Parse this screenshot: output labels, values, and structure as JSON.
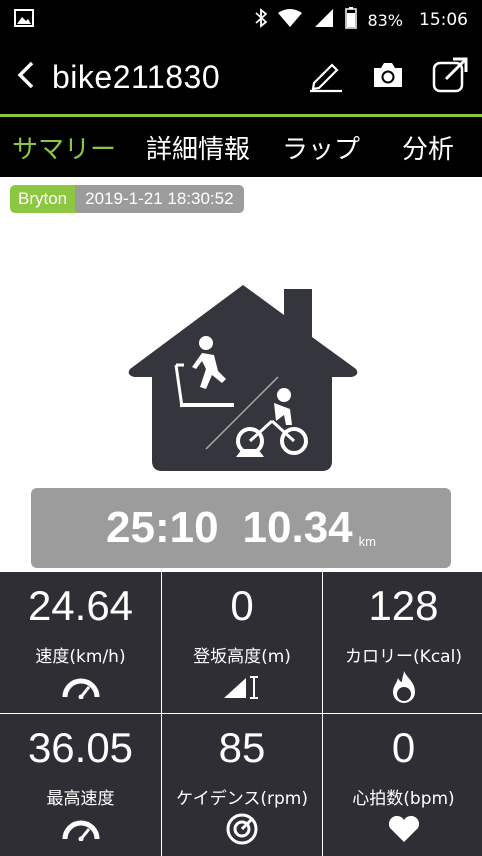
{
  "status_bar": {
    "battery": "83%",
    "time": "15:06"
  },
  "app_bar": {
    "title": "bike211830",
    "icons": [
      "back-arrow-icon",
      "pencil-icon",
      "camera-icon",
      "share-icon"
    ]
  },
  "tabs": [
    {
      "label": "サマリー",
      "active": true
    },
    {
      "label": "詳細情報",
      "active": false
    },
    {
      "label": "ラップ",
      "active": false
    },
    {
      "label": "分析",
      "active": false
    }
  ],
  "activity": {
    "brand": "Bryton",
    "datetime": "2019-1-21 18:30:52",
    "icon": "indoor-training-house-icon"
  },
  "summary": {
    "duration": "25:10",
    "distance": "10.34",
    "distance_unit": "km"
  },
  "stats": [
    {
      "value": "24.64",
      "label": "速度(km/h)",
      "icon": "speedometer-icon"
    },
    {
      "value": "0",
      "label": "登坂高度(m)",
      "icon": "elevation-icon"
    },
    {
      "value": "128",
      "label": "カロリー(Kcal)",
      "icon": "calorie-flame-icon"
    },
    {
      "value": "36.05",
      "label": "最高速度",
      "icon": "speedometer-icon"
    },
    {
      "value": "85",
      "label": "ケイデンス(rpm)",
      "icon": "cadence-icon"
    },
    {
      "value": "0",
      "label": "心拍数(bpm)",
      "icon": "heart-icon"
    }
  ],
  "colors": {
    "accent": "#8dc63f",
    "tile": "#2e2e34",
    "summary_box": "#9c9c9c"
  }
}
